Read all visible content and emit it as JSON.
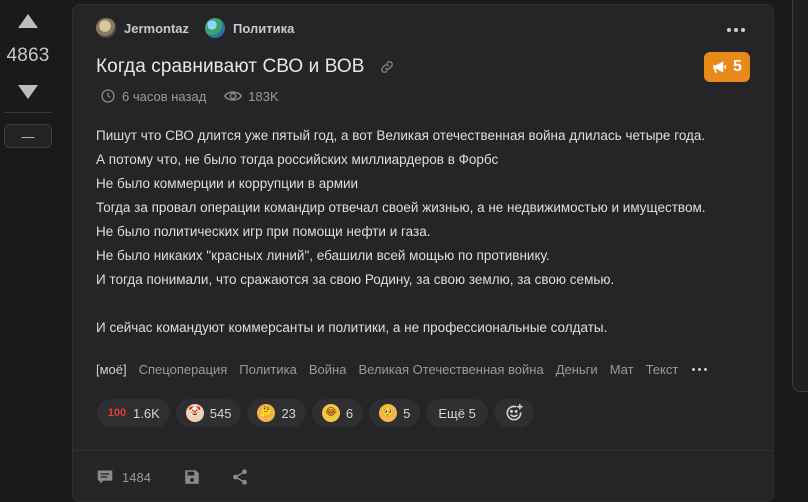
{
  "vote": {
    "score": "4863",
    "minus_label": "—"
  },
  "post": {
    "author": "Jermontaz",
    "community": "Политика",
    "title": "Когда сравнивают СВО и ВОВ",
    "rating": "5",
    "time_ago": "6 часов назад",
    "views": "183K",
    "content_lines": [
      "Пишут что СВО длится уже пятый год, а вот Великая отечественная война длилась четыре года.",
      "А потому что, не было тогда российских миллиардеров в Форбс",
      "Не было коммерции и коррупции в армии",
      "Тогда за провал операции командир отвечал своей жизнью, а не недвижимостью и имуществом.",
      "Не было политических игр при помощи нефти и газа.",
      "Не было никаких \"красных линий\", ебашили всей мощью по противнику.",
      "И тогда понимали, что сражаются за свою Родину, за свою землю, за свою семью."
    ],
    "content_last": "И сейчас командуют коммерсанты и политики, а не профессиональные солдаты.",
    "tags": [
      "[моё]",
      "Спецоперация",
      "Политика",
      "Война",
      "Великая Отечественная война",
      "Деньги",
      "Мат",
      "Текст"
    ]
  },
  "reactions": [
    {
      "icon": "hundred-points-icon",
      "count": "1.6K",
      "glyph": "100"
    },
    {
      "icon": "clown-face-icon",
      "count": "545",
      "glyph": "🤡"
    },
    {
      "icon": "thinking-face-icon",
      "count": "23",
      "glyph": "🤔"
    },
    {
      "icon": "laughing-face-icon",
      "count": "6",
      "glyph": "😂"
    },
    {
      "icon": "pleading-face-icon",
      "count": "5",
      "glyph": "🥺"
    }
  ],
  "reactions_more": "Ещё 5",
  "footer": {
    "comments_count": "1484"
  },
  "colors": {
    "accent": "#e88a1a",
    "background": "#1a1a1b",
    "card": "#252527"
  }
}
